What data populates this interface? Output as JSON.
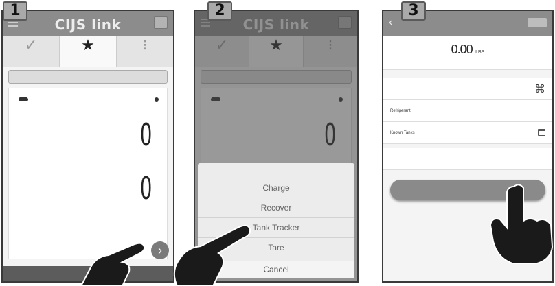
{
  "steps": [
    "1",
    "2",
    "3"
  ],
  "app": {
    "logo": "CIJS link",
    "tabs": [
      {
        "label": "",
        "icon": "✓"
      },
      {
        "label": "",
        "icon": "★"
      },
      {
        "label": "",
        "icon": "⁝"
      }
    ],
    "filter_label": "",
    "device": {
      "id": "",
      "meta": ""
    },
    "value_top": "0",
    "value_bottom": "0",
    "bottom": {
      "left": "",
      "right": ""
    },
    "fab_icon": "›"
  },
  "sheet": {
    "title": "",
    "items": [
      "Charge",
      "Recover",
      "Tank Tracker",
      "Tare"
    ],
    "cancel": "Cancel"
  },
  "detail": {
    "title": "",
    "save": "",
    "amount": "0.00",
    "amount_unit": "LBS",
    "rows": [
      {
        "label": "",
        "value": ""
      },
      {
        "label": "Refrigerant",
        "value": ""
      },
      {
        "label": "Known Tanks",
        "value": ""
      },
      {
        "label": "",
        "value": ""
      }
    ],
    "create_button": ""
  }
}
